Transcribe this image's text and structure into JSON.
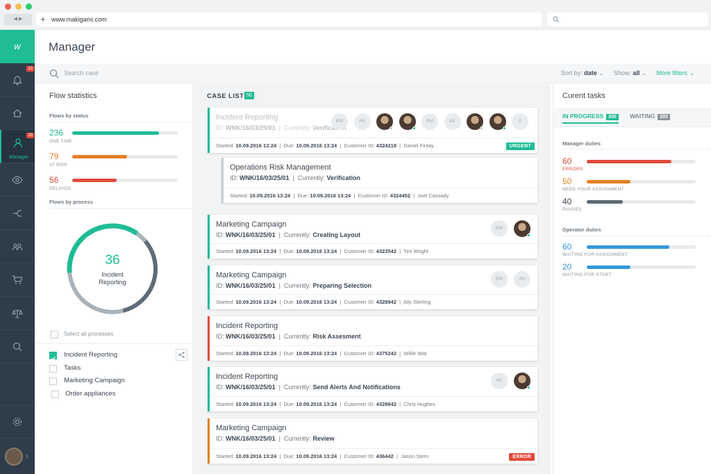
{
  "browser": {
    "url": "www.makigami.com",
    "nav": "◀ ▶"
  },
  "sidebar": {
    "logo": "w",
    "badges": {
      "notifications": "10",
      "manager": "10"
    },
    "active_label": "Manager",
    "items": [
      "bell-icon",
      "home-icon",
      "user-icon",
      "eye-icon",
      "flow-icon",
      "group-icon",
      "cart-icon",
      "balance-icon",
      "search-icon",
      "gear-icon"
    ]
  },
  "header": {
    "title": "Manager"
  },
  "toolbar": {
    "search_placeholder": "Search case",
    "sort_label": "Sort by:",
    "sort_value": "date",
    "show_label": "Show:",
    "show_value": "all",
    "more_filters": "More filters"
  },
  "flow": {
    "title": "Flow statistics",
    "by_status": "Flows by status",
    "statuses": [
      {
        "num": "236",
        "label": "ONE TIME",
        "pct": 0.82,
        "color": "#1fbc96"
      },
      {
        "num": "79",
        "label": "AT RISK",
        "pct": 0.52,
        "color": "#e67e22"
      },
      {
        "num": "56",
        "label": "DELAYED",
        "pct": 0.42,
        "color": "#e04b3c"
      }
    ],
    "by_process": "Flows by process",
    "donut": {
      "value": "36",
      "label1": "Incident",
      "label2": "Reporting"
    },
    "select_all": "Select all processes",
    "processes": [
      {
        "label": "Incident Reporting",
        "checked": true
      },
      {
        "label": "Tasks",
        "checked": false
      },
      {
        "label": "Marketing Campaign",
        "checked": false
      },
      {
        "label": "Order appliances",
        "checked": false
      }
    ]
  },
  "cases": {
    "title": "CASE LIST",
    "count": "50",
    "items": [
      {
        "title": "Incident Reporting",
        "id_label": "ID:",
        "id": "WNK/16/03/25/01",
        "cur_label": "Currently:",
        "current": "Verification",
        "started": "10.09.2016 13:24",
        "due": "10.09.2016 13:24",
        "customer": "4324218",
        "person": "Daniel Finlay",
        "tag": "URGENT"
      },
      {
        "title": "Operations Risk Management",
        "id_label": "ID:",
        "id": "WNK/16/03/25/01",
        "cur_label": "Currently:",
        "current": "Verification",
        "started": "10.09.2016 13:24",
        "due": "10.09.2016 13:24",
        "customer": "4324452",
        "person": "Joel Cassady",
        "tag": ""
      },
      {
        "title": "Marketing Campaign",
        "id_label": "ID:",
        "id": "WNK/16/03/25/01",
        "cur_label": "Currently:",
        "current": "Creating Layout",
        "started": "10.09.2016 13:24",
        "due": "10.09.2016 13:24",
        "customer": "4323542",
        "person": "Tim Wright",
        "tag": ""
      },
      {
        "title": "Marketing Campaign",
        "id_label": "ID:",
        "id": "WNK/16/03/25/01",
        "cur_label": "Currently:",
        "current": "Preparing Selection",
        "started": "10.09.2016 13:24",
        "due": "10.09.2016 13:24",
        "customer": "4328942",
        "person": "Ally Sterling",
        "tag": ""
      },
      {
        "title": "Incident Reporting",
        "id_label": "ID:",
        "id": "WNK/16/03/25/01",
        "cur_label": "Currently:",
        "current": "Risk Assesment",
        "started": "10.09.2016 13:24",
        "due": "10.09.2016 13:24",
        "customer": "4375242",
        "person": "Willie Wat",
        "tag": ""
      },
      {
        "title": "Incident Reporting",
        "id_label": "ID:",
        "id": "WNK/16/03/25/01",
        "cur_label": "Currently:",
        "current": "Send Alerts And Notifications",
        "started": "10.09.2016 13:24",
        "due": "10.09.2016 13:24",
        "customer": "4328842",
        "person": "Chris Hughes",
        "tag": ""
      },
      {
        "title": "Marketing Campaign",
        "id_label": "ID:",
        "id": "WNK/16/03/25/01",
        "cur_label": "Currently:",
        "current": "Review",
        "started": "10.09.2016 13:24",
        "due": "10.09.2016 13:24",
        "customer": "436442",
        "person": "Jason Stern",
        "tag": "ERROR"
      }
    ],
    "foot_labels": {
      "started": "Started:",
      "due": "Due:",
      "customer": "Customer ID:"
    },
    "avatars": {
      "bm": "BM",
      "ak": "AK",
      "more": "8"
    }
  },
  "tasks": {
    "title": "Curent tasks",
    "tab_progress": "IN PROGRESS",
    "tab_progress_count": "300",
    "tab_waiting": "WAITING",
    "tab_waiting_count": "200",
    "manager_head": "Manager duties",
    "manager": [
      {
        "num": "60",
        "label": "ERRORS",
        "pct": 0.78,
        "color": "#e04b3c"
      },
      {
        "num": "50",
        "label": "NEED YOUR ASSIGNMENT",
        "pct": 0.4,
        "color": "#e67e22"
      },
      {
        "num": "40",
        "label": "PAUSED",
        "pct": 0.33,
        "color": "#5a6773"
      }
    ],
    "operator_head": "Operator duties",
    "operator": [
      {
        "num": "60",
        "label": "WAITING FOR ASSIGNMENT",
        "pct": 0.76,
        "color": "#3498db"
      },
      {
        "num": "20",
        "label": "WAITING FOR START",
        "pct": 0.4,
        "color": "#3498db"
      }
    ]
  }
}
